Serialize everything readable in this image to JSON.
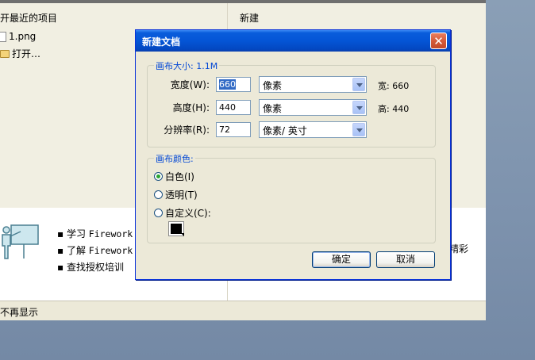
{
  "start_page": {
    "recent_title": "开最近的项目",
    "new_title": "新建",
    "recent_items": [
      "1.png",
      "打开…"
    ],
    "links": [
      {
        "prefix": "学习 ",
        "mono": "Firework"
      },
      {
        "prefix": "了解 ",
        "mono": "Firework"
      },
      {
        "prefix": "查找授权培训",
        "mono": ""
      }
    ],
    "right_snippet": "精彩",
    "dont_show": "不再显示"
  },
  "dialog": {
    "title": "新建文档",
    "close_glyph": "✕",
    "canvas_size": {
      "legend": "画布大小: 1.1M",
      "width_label": "宽度(W):",
      "width_value": "660",
      "width_unit": "像素",
      "width_info": "宽:  660",
      "height_label": "高度(H):",
      "height_value": "440",
      "height_unit": "像素",
      "height_info": "高:  440",
      "res_label": "分辨率(R):",
      "res_value": "72",
      "res_unit": "像素/ 英寸"
    },
    "canvas_color": {
      "legend": "画布颜色:",
      "options": [
        "白色(I)",
        "透明(T)",
        "自定义(C):"
      ],
      "selected": 0,
      "custom_color": "#000000"
    },
    "ok_label": "确定",
    "cancel_label": "取消"
  }
}
